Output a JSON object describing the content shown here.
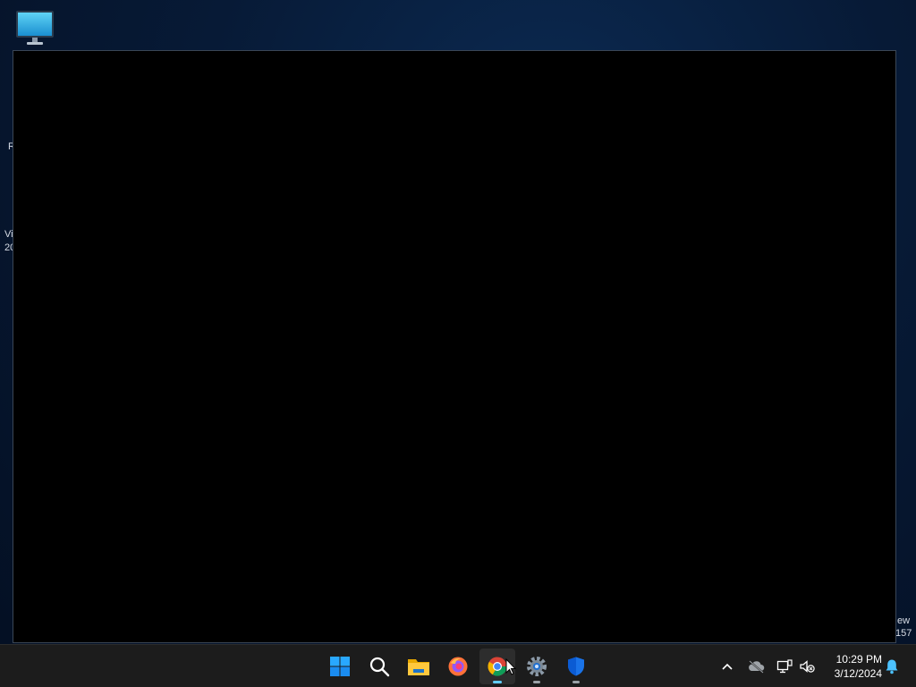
{
  "desktop": {
    "edge_texts": [
      "R",
      "Vi",
      "20",
      "ew",
      "157"
    ]
  },
  "window": {
    "title": ""
  },
  "taskbar": {
    "pinned": [
      {
        "name": "start-button",
        "icon": "windows-logo-icon"
      },
      {
        "name": "search-button",
        "icon": "search-icon"
      },
      {
        "name": "file-explorer-button",
        "icon": "folder-icon"
      },
      {
        "name": "firefox-button",
        "icon": "firefox-icon"
      },
      {
        "name": "chrome-button",
        "icon": "chrome-icon",
        "active": true
      },
      {
        "name": "settings-button",
        "icon": "gear-icon"
      },
      {
        "name": "defender-button",
        "icon": "shield-icon"
      }
    ],
    "tray": {
      "time": "10:29 PM",
      "date": "3/12/2024"
    }
  },
  "colors": {
    "accent": "#60cdff",
    "windows_blue": "#0078d4",
    "taskbar": "#1c1c1c"
  }
}
